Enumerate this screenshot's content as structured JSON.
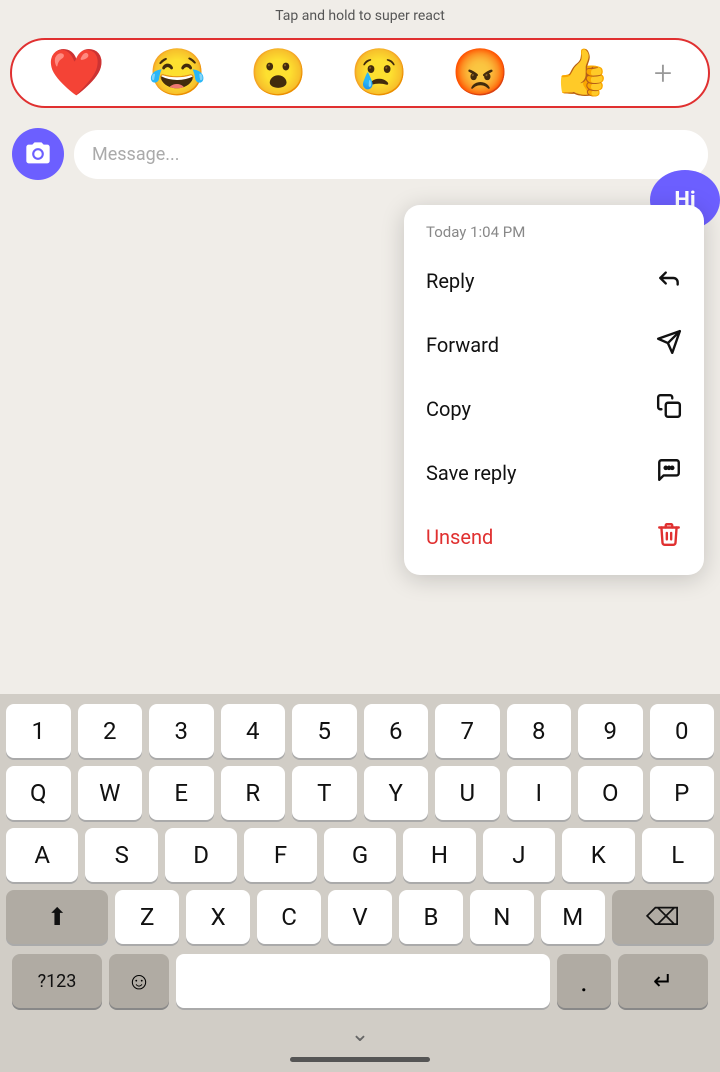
{
  "hint": {
    "text": "Tap and hold to super react"
  },
  "emoji_bar": {
    "emojis": [
      "❤️",
      "😂",
      "😮",
      "😢",
      "😡",
      "👍"
    ],
    "plus_label": "+"
  },
  "message_input": {
    "placeholder": "Message..."
  },
  "hi_bubble": {
    "text": "Hi"
  },
  "context_menu": {
    "timestamp": "Today 1:04 PM",
    "items": [
      {
        "label": "Reply",
        "icon": "reply-icon"
      },
      {
        "label": "Forward",
        "icon": "forward-icon"
      },
      {
        "label": "Copy",
        "icon": "copy-icon"
      },
      {
        "label": "Save reply",
        "icon": "save-reply-icon"
      },
      {
        "label": "Unsend",
        "icon": "unsend-icon",
        "type": "danger"
      }
    ]
  },
  "keyboard": {
    "row1": [
      "1",
      "2",
      "3",
      "4",
      "5",
      "6",
      "7",
      "8",
      "9",
      "0"
    ],
    "row2": [
      "Q",
      "W",
      "E",
      "R",
      "T",
      "Y",
      "U",
      "I",
      "O",
      "P"
    ],
    "row3": [
      "A",
      "S",
      "D",
      "F",
      "G",
      "H",
      "J",
      "K",
      "L"
    ],
    "row4": [
      "Z",
      "X",
      "C",
      "V",
      "B",
      "N",
      "M"
    ],
    "special": {
      "shift": "⬆",
      "backspace": "⌫",
      "numbers": "?123",
      "emoji": "☺",
      "space": "",
      "period": ".",
      "enter": "↵"
    }
  }
}
